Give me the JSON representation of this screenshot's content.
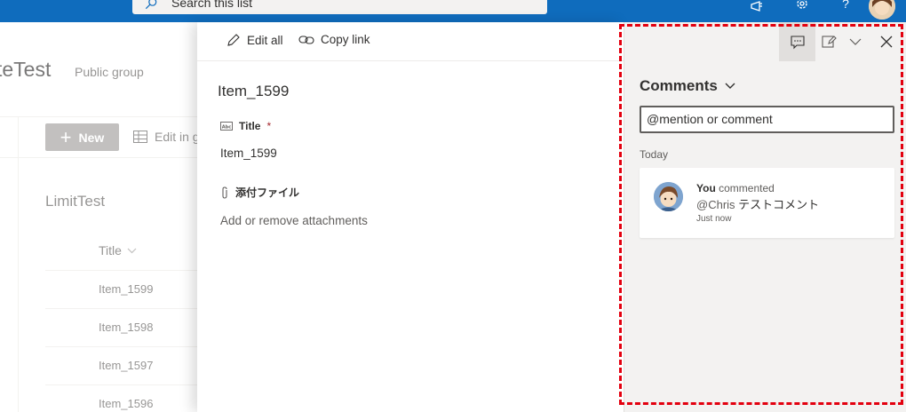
{
  "suitebar": {
    "search_placeholder": "Search this list",
    "icons": [
      "megaphone-icon",
      "gear-icon",
      "help-icon",
      "avatar"
    ]
  },
  "site": {
    "title": "teTest",
    "subtitle": "Public group"
  },
  "list": {
    "new_label": "New",
    "edit_label": "Edit in g",
    "name": "LimitTest",
    "column_title": "Title",
    "rows": [
      "Item_1599",
      "Item_1598",
      "Item_1597",
      "Item_1596"
    ]
  },
  "panel": {
    "edit_all": "Edit all",
    "copy_link": "Copy link",
    "item_title": "Item_1599",
    "title_label": "Title",
    "required_mark": "*",
    "title_value": "Item_1599",
    "attach_label": "添付ファイル",
    "attach_action": "Add or remove attachments"
  },
  "comments": {
    "heading": "Comments",
    "input_value": "@mention or comment",
    "group_label": "Today",
    "entries": [
      {
        "author": "You",
        "verb": "commented",
        "mention": "@Chris",
        "text": "テストコメント",
        "time": "Just now"
      }
    ]
  },
  "colors": {
    "suitebar": "#0f6cbd",
    "highlight": "#e3000f",
    "pane_bg": "#f3f2f1"
  }
}
